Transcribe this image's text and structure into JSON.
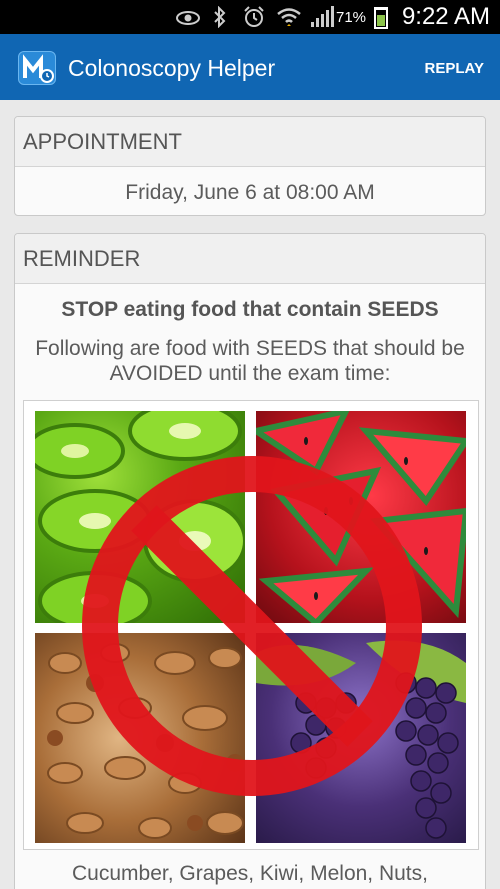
{
  "status_bar": {
    "battery_text": "71%",
    "time": "9:22 AM"
  },
  "app": {
    "title": "Colonoscopy Helper",
    "replay_label": "REPLAY"
  },
  "appointment": {
    "header": "APPOINTMENT",
    "value": "Friday, June 6 at 08:00 AM"
  },
  "reminder": {
    "header": "REMINDER",
    "title": "STOP eating food that contain SEEDS",
    "text": "Following are food with SEEDS that should be AVOIDED until the exam time:",
    "list": "Cucumber, Grapes, Kiwi, Melon, Nuts,"
  },
  "colors": {
    "action_bar": "#1066b3",
    "no_sign": "#e0151b"
  }
}
